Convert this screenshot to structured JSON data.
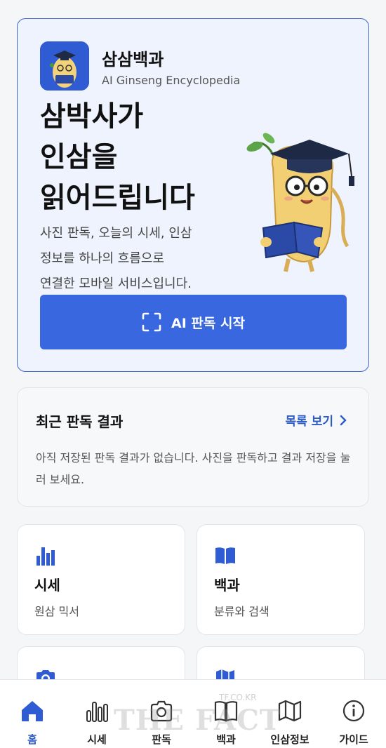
{
  "hero": {
    "app_name": "삼삼백과",
    "app_subtitle": "AI Ginseng Encyclopedia",
    "headline": [
      "삼박사가",
      "인삼을",
      "읽어드립니다"
    ],
    "description": [
      "사진 판독, 오늘의 시세, 인삼",
      "정보를 하나의 흐름으로",
      "연결한 모바일 서비스입니다."
    ],
    "cta_label": "AI 판독 시작",
    "accent_color": "#3867e0"
  },
  "recent": {
    "title": "최근 판독 결과",
    "link_label": "목록 보기",
    "empty_text": "아직 저장된 판독 결과가 없습니다. 사진을 판독하고 결과 저장을 눌러 보세요."
  },
  "cards": [
    {
      "icon": "bar-chart-icon",
      "title": "시세",
      "subtitle": "원삼 믹서"
    },
    {
      "icon": "book-icon",
      "title": "백과",
      "subtitle": "분류와 검색"
    },
    {
      "icon": "camera-icon",
      "title": "",
      "subtitle": ""
    },
    {
      "icon": "map-icon",
      "title": "",
      "subtitle": ""
    }
  ],
  "nav": [
    {
      "icon": "home-icon",
      "label": "홈",
      "active": true
    },
    {
      "icon": "bar-chart-icon",
      "label": "시세"
    },
    {
      "icon": "camera-icon",
      "label": "판독"
    },
    {
      "icon": "book-icon",
      "label": "백과"
    },
    {
      "icon": "map-icon",
      "label": "인삼정보"
    },
    {
      "icon": "info-icon",
      "label": "가이드"
    }
  ],
  "watermark": {
    "small": "TF.CO.KR",
    "large": "THE FACT"
  }
}
